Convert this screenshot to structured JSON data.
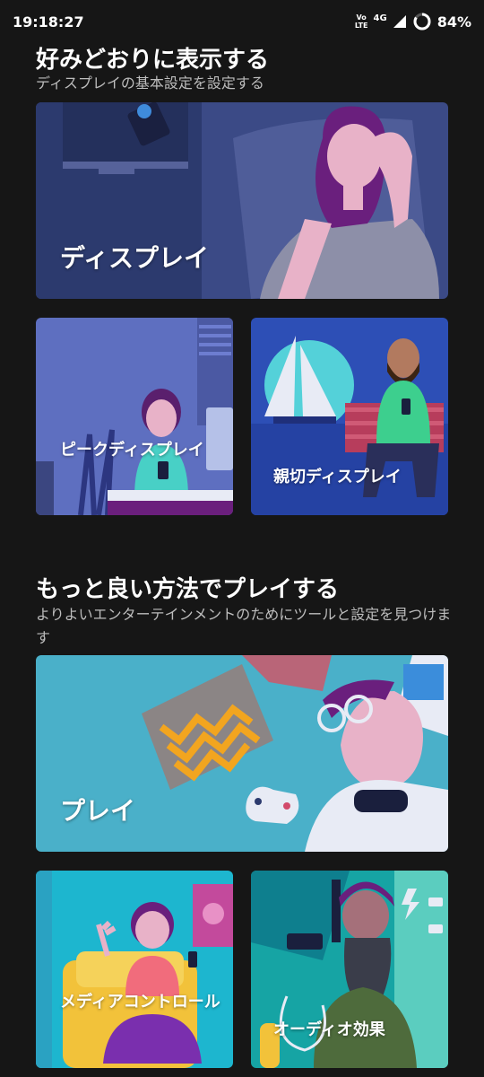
{
  "status_bar": {
    "time": "19:18:27",
    "volte_top": "Vo",
    "volte_bottom": "LTE",
    "network": "4G",
    "battery": "84%"
  },
  "section_display": {
    "title": "好みどおりに表示する",
    "subtitle": "ディスプレイの基本設定を設定する",
    "cards": {
      "display": "ディスプレイ",
      "peek_display": "ピークディスプレイ",
      "attentive_display": "親切ディスプレイ"
    }
  },
  "section_play": {
    "title": "もっと良い方法でプレイする",
    "subtitle": "よりよいエンターテインメントのためにツールと設定を見つけます",
    "cards": {
      "play": "プレイ",
      "media_controls": "メディアコントロール",
      "audio_effects": "オーディオ効果"
    }
  },
  "colors": {
    "background": "#161616",
    "subtitle": "#bdbdbd"
  }
}
